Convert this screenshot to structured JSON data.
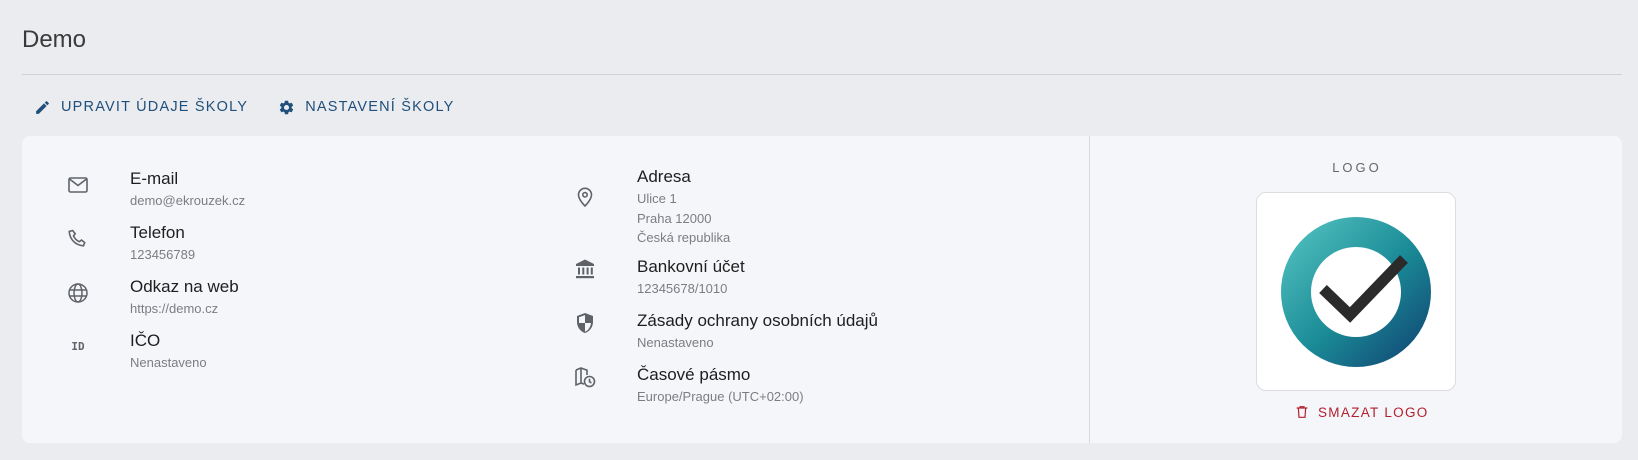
{
  "page": {
    "title": "Demo"
  },
  "actions": {
    "edit_label": "UPRAVIT ÚDAJE ŠKOLY",
    "settings_label": "NASTAVENÍ ŠKOLY"
  },
  "left_info": {
    "email": {
      "label": "E-mail",
      "value": "demo@ekrouzek.cz",
      "icon": "mail-icon"
    },
    "phone": {
      "label": "Telefon",
      "value": "123456789",
      "icon": "phone-icon"
    },
    "web": {
      "label": "Odkaz na web",
      "value": "https://demo.cz",
      "icon": "globe-icon"
    },
    "ico": {
      "label": "IČO",
      "value": "Nenastaveno",
      "icon": "id-icon",
      "icon_text": "ID"
    }
  },
  "right_info": {
    "address": {
      "label": "Adresa",
      "lines": [
        "Ulice 1",
        "Praha 12000",
        "Česká republika"
      ],
      "icon": "location-pin-icon"
    },
    "bank": {
      "label": "Bankovní účet",
      "value": "12345678/1010",
      "icon": "bank-icon"
    },
    "privacy": {
      "label": "Zásady ochrany osobních údajů",
      "value": "Nenastaveno",
      "icon": "shield-icon"
    },
    "timezone": {
      "label": "Časové pásmo",
      "value": "Europe/Prague (UTC+02:00)",
      "icon": "map-clock-icon"
    }
  },
  "logo": {
    "title": "LOGO",
    "delete_label": "SMAZAT LOGO",
    "ring_colors": [
      "#4cbcbc",
      "#1a8a96",
      "#124e78"
    ],
    "check_color": "#2b2b2b"
  }
}
